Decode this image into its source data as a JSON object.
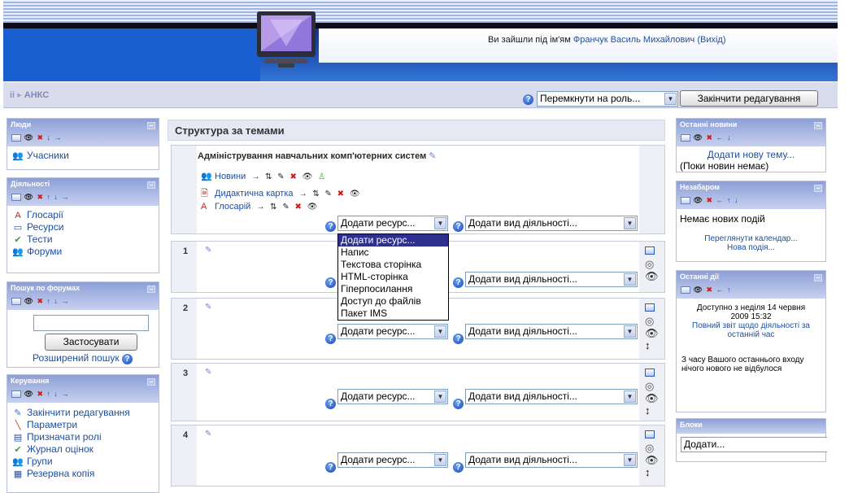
{
  "header": {
    "login_prefix": "Ви зайшли під ім'ям",
    "user_name": "Франчук Василь Михайлович",
    "logout": "(Вихід)"
  },
  "navbar": {
    "breadcrumb_home": "ii",
    "breadcrumb_current": "АНКС",
    "role_switch": "Перемкнути на роль...",
    "stop_editing": "Закінчити редагування"
  },
  "people_block": {
    "title": "Люди",
    "items": [
      {
        "label": "Учасники",
        "icon": "participants-icon"
      }
    ]
  },
  "activities_block": {
    "title": "Діяльності",
    "items": [
      {
        "label": "Глосарії",
        "icon": "glossary-icon"
      },
      {
        "label": "Ресурси",
        "icon": "resources-icon"
      },
      {
        "label": "Тести",
        "icon": "quiz-icon"
      },
      {
        "label": "Форуми",
        "icon": "forum-icon"
      }
    ]
  },
  "search_block": {
    "title": "Пошук по форумах",
    "input_value": "",
    "apply": "Застосувати",
    "advanced": "Розширений пошук"
  },
  "admin_block": {
    "title": "Керування",
    "items": [
      {
        "label": "Закінчити редагування",
        "icon": "edit-icon"
      },
      {
        "label": "Параметри",
        "icon": "settings-icon"
      },
      {
        "label": "Призначати ролі",
        "icon": "roles-icon"
      },
      {
        "label": "Журнал оцінок",
        "icon": "grades-icon"
      },
      {
        "label": "Групи",
        "icon": "groups-icon"
      },
      {
        "label": "Резервна копія",
        "icon": "backup-icon"
      }
    ]
  },
  "main": {
    "title": "Структура за темами",
    "section0_title": "Адміністрування навчальних комп'ютерних систем",
    "resources": [
      {
        "label": "Новини",
        "icon": "forum-icon"
      },
      {
        "label": "Дидактична картка",
        "icon": "pdf-icon"
      },
      {
        "label": "Глосарій",
        "icon": "glossary-icon"
      }
    ],
    "add_resource": "Додати ресурс...",
    "add_activity": "Додати вид діяльності...",
    "sections": [
      {
        "num": "1"
      },
      {
        "num": "2"
      },
      {
        "num": "3"
      },
      {
        "num": "4"
      }
    ],
    "dropdown_options": [
      "Додати ресурс...",
      "Напис",
      "Текстова сторінка",
      "HTML-сторінка",
      "Гіперпосилання",
      "Доступ до файлів",
      "Пакет IMS"
    ]
  },
  "news_block": {
    "title": "Останні новини",
    "add_topic": "Додати нову тему...",
    "empty": "(Поки новин немає)"
  },
  "upcoming_block": {
    "title": "Незабаром",
    "empty": "Немає нових подій",
    "calendar": "Переглянути календар...",
    "new_event": "Нова подія..."
  },
  "recent_block": {
    "title": "Останні дії",
    "since_line1": "Доступно з неділя 14 червня",
    "since_line2": "2009 15:32",
    "full_report": "Повний звіт щодо діяльності за останній час",
    "nothing_new": "З часу Вашого останнього входу нічого нового не відбулося"
  },
  "blocks_block": {
    "title": "Блоки",
    "add": "Додати..."
  },
  "colors": {
    "header_blue": "#1a3f98",
    "link_blue": "#1d4e9c",
    "block_header": "#8c9fd7",
    "dropdown_selected": "#2f2f8f"
  }
}
